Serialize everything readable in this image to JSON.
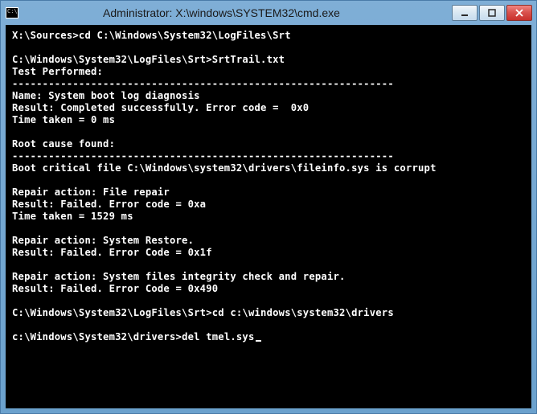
{
  "window": {
    "title": "Administrator: X:\\windows\\SYSTEM32\\cmd.exe"
  },
  "terminal": {
    "lines": [
      {
        "type": "prompt",
        "prompt": "X:\\Sources>",
        "command": "cd C:\\Windows\\System32\\LogFiles\\Srt"
      },
      {
        "type": "blank"
      },
      {
        "type": "prompt",
        "prompt": "C:\\Windows\\System32\\LogFiles\\Srt>",
        "command": "SrtTrail.txt"
      },
      {
        "type": "output",
        "text": "Test Performed:"
      },
      {
        "type": "rule"
      },
      {
        "type": "output",
        "text": "Name: System boot log diagnosis"
      },
      {
        "type": "output",
        "text": "Result: Completed successfully. Error code =  0x0"
      },
      {
        "type": "output",
        "text": "Time taken = 0 ms"
      },
      {
        "type": "blank"
      },
      {
        "type": "output",
        "text": "Root cause found:"
      },
      {
        "type": "rule"
      },
      {
        "type": "output",
        "text": "Boot critical file C:\\Windows\\system32\\drivers\\fileinfo.sys is corrupt"
      },
      {
        "type": "blank"
      },
      {
        "type": "output",
        "text": "Repair action: File repair"
      },
      {
        "type": "output",
        "text": "Result: Failed. Error code = 0xa"
      },
      {
        "type": "output",
        "text": "Time taken = 1529 ms"
      },
      {
        "type": "blank"
      },
      {
        "type": "output",
        "text": "Repair action: System Restore."
      },
      {
        "type": "output",
        "text": "Result: Failed. Error Code = 0x1f"
      },
      {
        "type": "blank"
      },
      {
        "type": "output",
        "text": "Repair action: System files integrity check and repair."
      },
      {
        "type": "output",
        "text": "Result: Failed. Error Code = 0x490"
      },
      {
        "type": "blank"
      },
      {
        "type": "prompt",
        "prompt": "C:\\Windows\\System32\\LogFiles\\Srt>",
        "command": "cd c:\\windows\\system32\\drivers"
      },
      {
        "type": "blank"
      },
      {
        "type": "prompt",
        "prompt": "c:\\Windows\\System32\\drivers>",
        "command": "del tmel.sys",
        "cursor": true
      }
    ],
    "rule_char": "-",
    "rule_width": 63
  }
}
